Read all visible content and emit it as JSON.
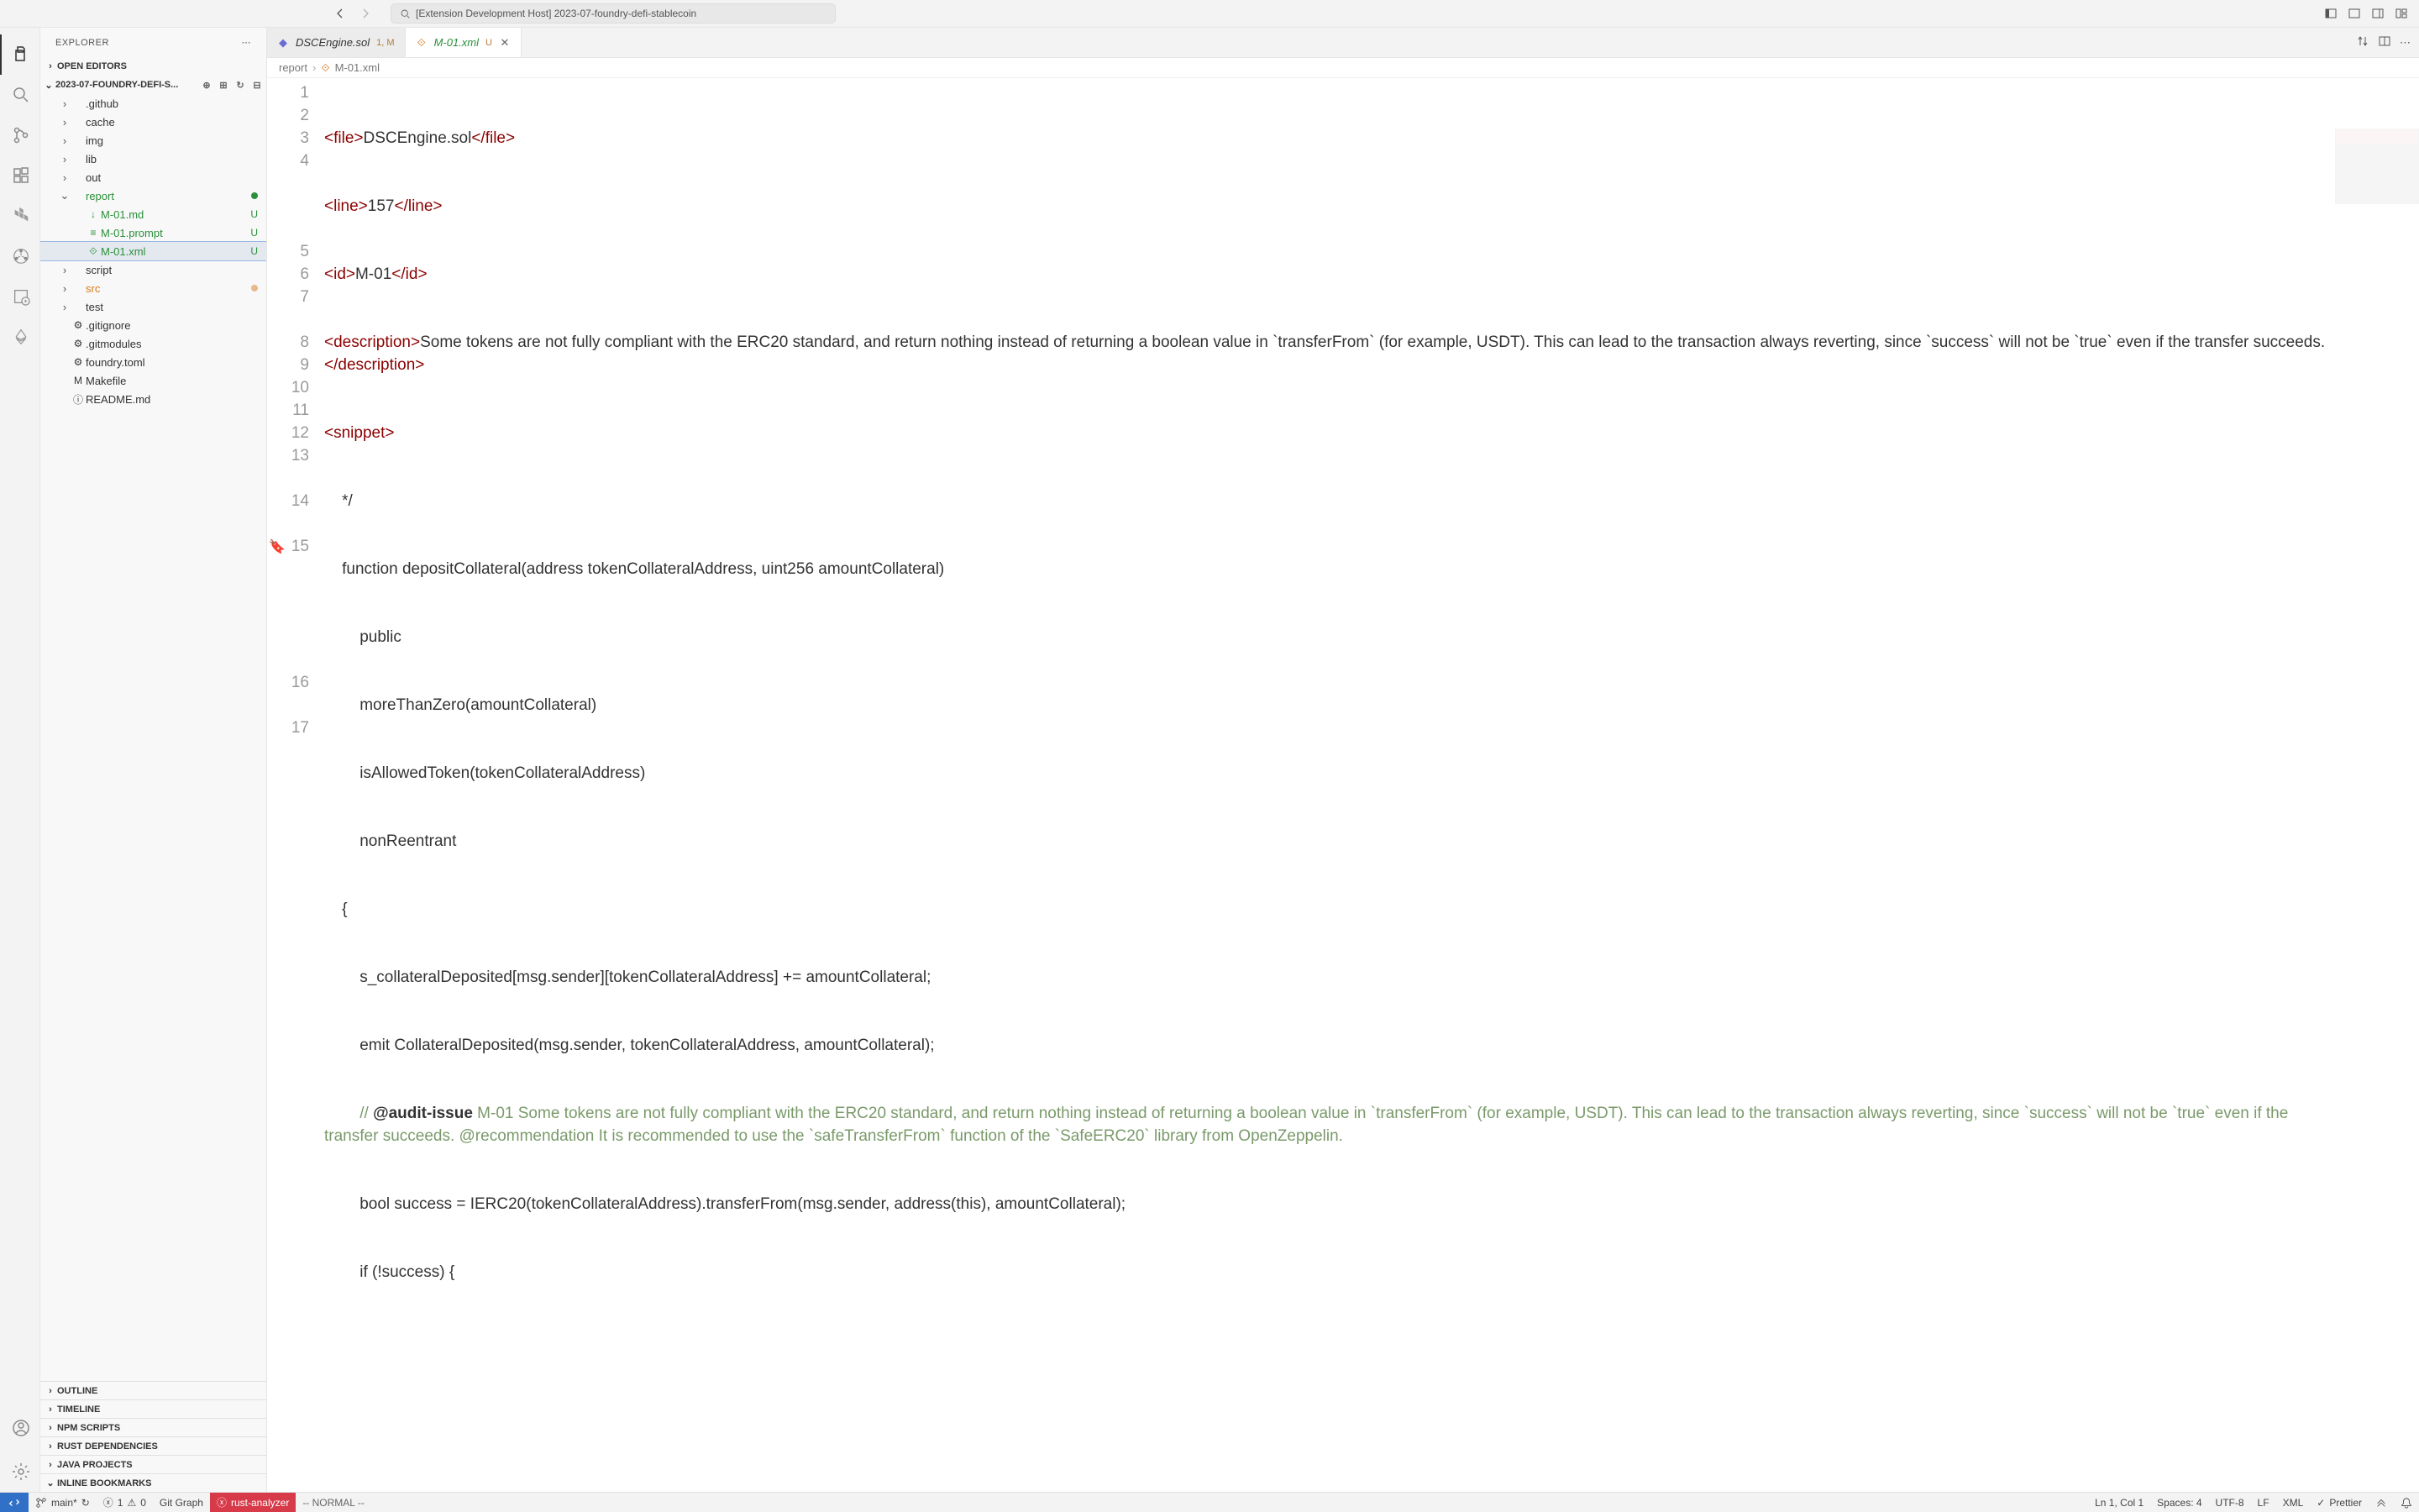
{
  "title": "[Extension Development Host] 2023-07-foundry-defi-stablecoin",
  "explorer": {
    "label": "EXPLORER"
  },
  "sections": {
    "openEditors": "OPEN EDITORS",
    "project": "2023-07-FOUNDRY-DEFI-S...",
    "outline": "OUTLINE",
    "timeline": "TIMELINE",
    "npm": "NPM SCRIPTS",
    "rust": "RUST DEPENDENCIES",
    "java": "JAVA PROJECTS",
    "bookmarks": "INLINE BOOKMARKS"
  },
  "tree": [
    {
      "icon": "›",
      "name": ".github",
      "indent": 1
    },
    {
      "icon": "›",
      "name": "cache",
      "indent": 1
    },
    {
      "icon": "›",
      "name": "img",
      "indent": 1
    },
    {
      "icon": "›",
      "name": "lib",
      "indent": 1
    },
    {
      "icon": "›",
      "name": "out",
      "indent": 1
    },
    {
      "icon": "⌄",
      "name": "report",
      "indent": 1,
      "class": "green",
      "dot": "green-dot"
    },
    {
      "icon": "",
      "name": "M-01.md",
      "indent": 2,
      "class": "green",
      "badge": "U",
      "ficon": "↓"
    },
    {
      "icon": "",
      "name": "M-01.prompt",
      "indent": 2,
      "class": "green",
      "badge": "U",
      "ficon": "≡"
    },
    {
      "icon": "",
      "name": "M-01.xml",
      "indent": 2,
      "class": "green",
      "badge": "U",
      "ficon": "⟐",
      "selected": true
    },
    {
      "icon": "›",
      "name": "script",
      "indent": 1
    },
    {
      "icon": "›",
      "name": "src",
      "indent": 1,
      "class": "orange",
      "dot": "orange-dot"
    },
    {
      "icon": "›",
      "name": "test",
      "indent": 1
    },
    {
      "icon": "",
      "name": ".gitignore",
      "indent": 1,
      "ficon": "⚙"
    },
    {
      "icon": "",
      "name": ".gitmodules",
      "indent": 1,
      "ficon": "⚙"
    },
    {
      "icon": "",
      "name": "foundry.toml",
      "indent": 1,
      "ficon": "⚙"
    },
    {
      "icon": "",
      "name": "Makefile",
      "indent": 1,
      "ficon": "M"
    },
    {
      "icon": "",
      "name": "README.md",
      "indent": 1,
      "ficon": "ⓘ"
    }
  ],
  "tabs": [
    {
      "name": "DSCEngine.sol",
      "mod": "1, M",
      "icon": "◆",
      "iconColor": "#6b6bd6"
    },
    {
      "name": "M-01.xml",
      "mod": "U",
      "icon": "⟐",
      "iconColor": "#d77a1b",
      "active": true,
      "close": true,
      "class": "green"
    }
  ],
  "breadcrumb": {
    "a": "report",
    "b": "M-01.xml"
  },
  "code": {
    "l1": {
      "open": "<file>",
      "text": "DSCEngine.sol",
      "close": "</file>"
    },
    "l2": {
      "open": "<line>",
      "text": "157",
      "close": "</line>"
    },
    "l3": {
      "open": "<id>",
      "text": "M-01",
      "close": "</id>"
    },
    "l4": {
      "open": "<description>",
      "text": "Some tokens are not fully compliant with the ERC20 standard, and return nothing instead of returning a boolean value in `transferFrom` (for example, USDT). This can lead to the transaction always reverting, since `success` will not be `true` even if the transfer succeeds. ",
      "close": "</description>"
    },
    "l5": {
      "open": "<snippet>"
    },
    "l6": "    */",
    "l7": "    function depositCollateral(address tokenCollateralAddress, uint256 amountCollateral)",
    "l8": "        public",
    "l9": "        moreThanZero(amountCollateral)",
    "l10": "        isAllowedToken(tokenCollateralAddress)",
    "l11": "        nonReentrant",
    "l12": "    {",
    "l13": "        s_collateralDeposited[msg.sender][tokenCollateralAddress] += amountCollateral;",
    "l14": "        emit CollateralDeposited(msg.sender, tokenCollateralAddress, amountCollateral);",
    "l15a": "        // ",
    "l15b": "@audit-issue",
    "l15c": " M-01 Some tokens are not fully compliant with the ERC20 standard, and return nothing instead of returning a boolean value in `transferFrom` (for example, USDT). This can lead to the transaction always reverting, since `success` will not be `true` even if the transfer succeeds. @recommendation It is recommended to use the `safeTransferFrom` function of the `SafeERC20` library from OpenZeppelin.",
    "l16": "        bool success = IERC20(tokenCollateralAddress).transferFrom(msg.sender, address(this), amountCollateral);",
    "l17": "        if (!success) {"
  },
  "status": {
    "branch": "main*",
    "sync": "↻",
    "errors": "1",
    "warnings": "0",
    "gitgraph": "Git Graph",
    "rust": "rust-analyzer",
    "vim": "-- NORMAL --",
    "pos": "Ln 1, Col 1",
    "spaces": "Spaces: 4",
    "enc": "UTF-8",
    "eol": "LF",
    "lang": "XML",
    "prettier": "Prettier"
  }
}
